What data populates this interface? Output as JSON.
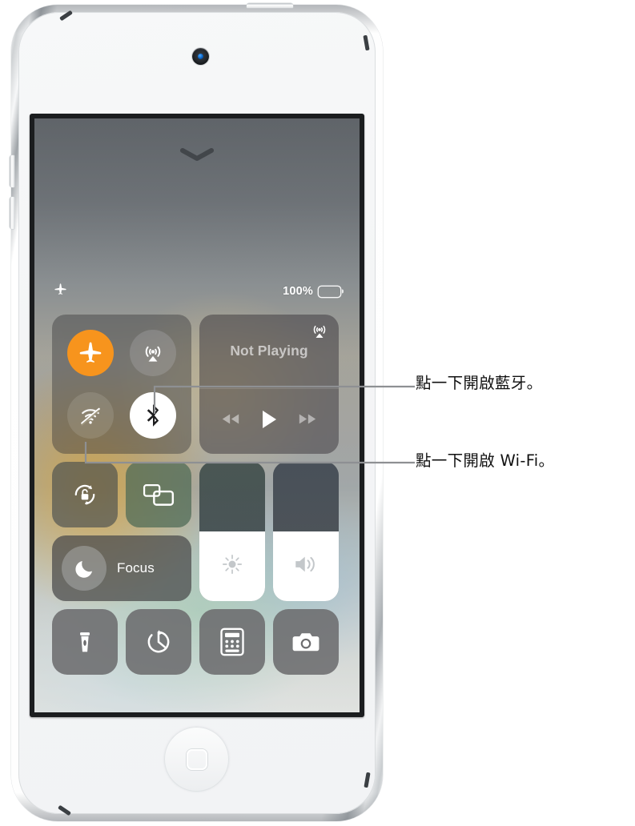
{
  "device": {
    "name": "ipod-touch",
    "color": "#f4f5f6",
    "camera_label": "front-camera",
    "home_button_label": "home-button"
  },
  "screen": {
    "chevron_label": "dismiss-control-center",
    "status_bar": {
      "airplane_icon": "airplane-icon",
      "battery_percent": "100%",
      "battery_icon": "battery-full-icon"
    },
    "control_center": {
      "connectivity": {
        "airplane": {
          "label": "airplane-mode",
          "state": "on",
          "color": "#f7941d"
        },
        "airdrop": {
          "label": "airdrop",
          "state": "off"
        },
        "wifi": {
          "label": "wi-fi",
          "state": "off"
        },
        "bluetooth": {
          "label": "bluetooth",
          "state": "on",
          "color": "#ffffff"
        }
      },
      "now_playing": {
        "title": "Not Playing",
        "airplay_icon": "airplay-icon",
        "rewind_icon": "rewind-icon",
        "play_icon": "play-icon",
        "forward_icon": "fast-forward-icon"
      },
      "rotation_lock": {
        "label": "rotation-lock",
        "state": "off"
      },
      "screen_mirroring": {
        "label": "screen-mirroring"
      },
      "focus": {
        "label": "Focus",
        "icon": "moon-icon"
      },
      "brightness": {
        "label": "brightness",
        "icon": "sun-icon",
        "value": 50
      },
      "volume": {
        "label": "volume",
        "icon": "speaker-icon",
        "value": 50
      },
      "shortcuts": [
        {
          "label": "flashlight",
          "icon": "flashlight-icon"
        },
        {
          "label": "timer",
          "icon": "timer-icon"
        },
        {
          "label": "calculator",
          "icon": "calculator-icon"
        },
        {
          "label": "camera",
          "icon": "camera-icon"
        }
      ]
    }
  },
  "callouts": [
    {
      "id": "bluetooth",
      "text": "點一下開啟藍牙。"
    },
    {
      "id": "wifi",
      "text": "點一下開啟 Wi-Fi。"
    }
  ]
}
